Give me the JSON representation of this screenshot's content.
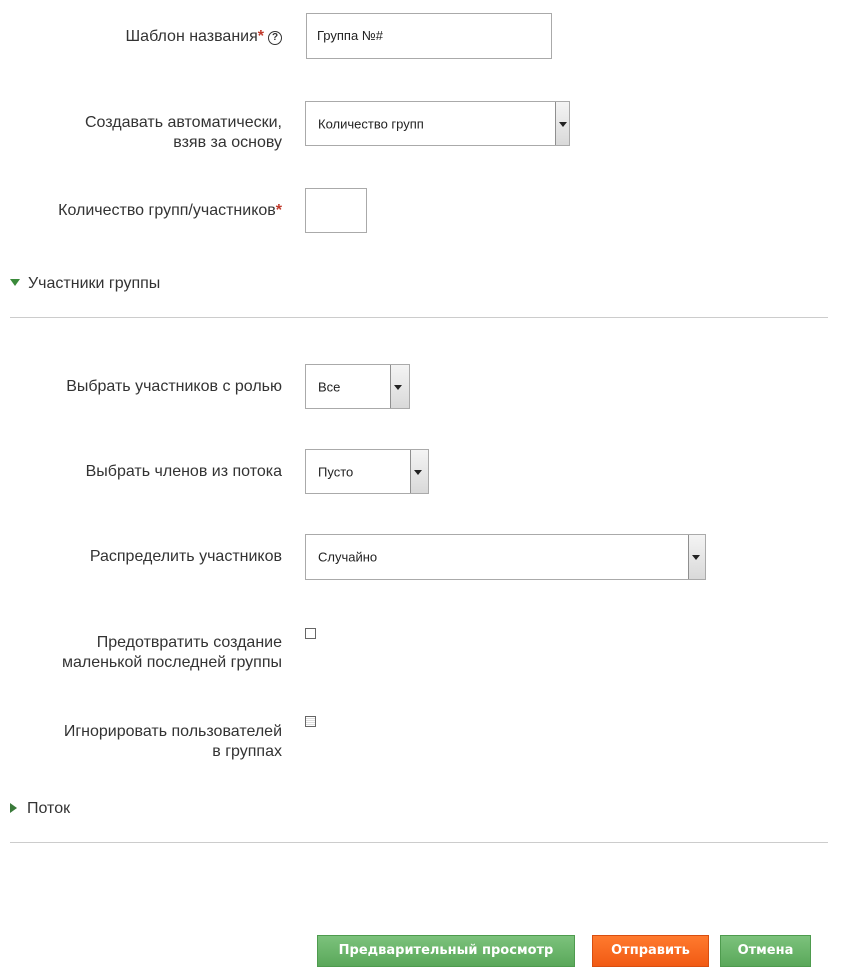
{
  "form": {
    "name_template": {
      "label": "Шаблон названия",
      "required_mark": "*",
      "help_icon_glyph": "?",
      "help_icon": "question-circle-icon",
      "value": "Группа №#"
    },
    "auto_create": {
      "label_line1": "Создавать автоматически,",
      "label_line2": "взяв за основу",
      "selected": "Количество групп"
    },
    "count": {
      "label": "Количество групп/участников",
      "required_mark": "*",
      "value": ""
    }
  },
  "members_section": {
    "title": "Участники группы",
    "expanded_icon": "triangle-down-icon"
  },
  "members": {
    "role": {
      "label": "Выбрать участников с ролью",
      "selected": "Все"
    },
    "cohort": {
      "label": "Выбрать членов из потока",
      "selected": "Пусто"
    },
    "allocate": {
      "label": "Распределить участников",
      "selected": "Случайно"
    },
    "prevent_small": {
      "label_line1": "Предотвратить создание",
      "label_line2": "маленькой последней группы",
      "checked": false
    },
    "ignore_grouped": {
      "label_line1": "Игнорировать пользователей",
      "label_line2": "в группах",
      "checked": false
    }
  },
  "cohort_section": {
    "title": "Поток",
    "collapsed_icon": "triangle-right-icon"
  },
  "buttons": {
    "preview": "Предварительный просмотр",
    "submit": "Отправить",
    "cancel": "Отмена"
  },
  "colors": {
    "button_green": "#5aa85a",
    "button_orange": "#f15a14",
    "required": "#c0392b",
    "section_triangle": "#3a8a3a"
  }
}
